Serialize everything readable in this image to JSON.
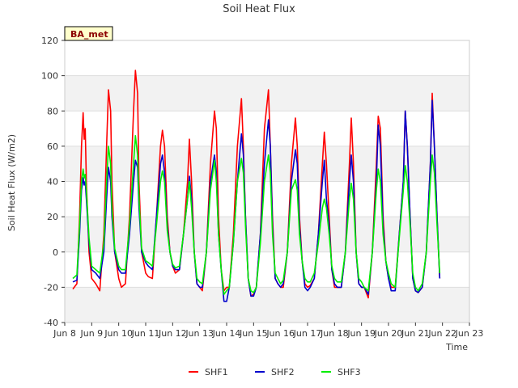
{
  "chart_data": {
    "type": "line",
    "title": "Soil Heat Flux",
    "xlabel": "Time",
    "ylabel": "Soil Heat Flux (W/m2)",
    "site_label": "BA_met",
    "ylim": [
      -40,
      120
    ],
    "yticks": [
      -40,
      -20,
      0,
      20,
      40,
      60,
      80,
      100,
      120
    ],
    "xlim": [
      8,
      23
    ],
    "xticks": [
      {
        "v": 8,
        "label": "Jun 8"
      },
      {
        "v": 9,
        "label": "Jun 9"
      },
      {
        "v": 10,
        "label": "Jun 10"
      },
      {
        "v": 11,
        "label": "Jun 11"
      },
      {
        "v": 12,
        "label": "Jun 12"
      },
      {
        "v": 13,
        "label": "Jun 13"
      },
      {
        "v": 14,
        "label": "Jun 14"
      },
      {
        "v": 15,
        "label": "Jun 15"
      },
      {
        "v": 16,
        "label": "Jun 16"
      },
      {
        "v": 17,
        "label": "Jun 17"
      },
      {
        "v": 18,
        "label": "Jun 18"
      },
      {
        "v": 19,
        "label": "Jun 19"
      },
      {
        "v": 20,
        "label": "Jun 20"
      },
      {
        "v": 21,
        "label": "Jun 21"
      },
      {
        "v": 22,
        "label": "Jun 22"
      },
      {
        "v": 23,
        "label": "Jun 23"
      }
    ],
    "grid": true,
    "legend_position": "bottom-center",
    "series": [
      {
        "name": "SHF1",
        "color": "#ff0000",
        "x": [
          8.3,
          8.45,
          8.55,
          8.62,
          8.68,
          8.72,
          8.76,
          8.8,
          8.9,
          9.0,
          9.15,
          9.3,
          9.45,
          9.55,
          9.62,
          9.7,
          9.75,
          9.85,
          10.0,
          10.1,
          10.25,
          10.4,
          10.55,
          10.62,
          10.7,
          10.75,
          10.85,
          11.0,
          11.1,
          11.25,
          11.4,
          11.55,
          11.62,
          11.7,
          11.8,
          11.9,
          12.0,
          12.1,
          12.25,
          12.4,
          12.55,
          12.62,
          12.7,
          12.8,
          12.9,
          13.0,
          13.1,
          13.25,
          13.4,
          13.55,
          13.62,
          13.7,
          13.8,
          13.9,
          14.0,
          14.1,
          14.25,
          14.4,
          14.55,
          14.62,
          14.7,
          14.8,
          14.9,
          15.0,
          15.1,
          15.25,
          15.4,
          15.55,
          15.62,
          15.7,
          15.8,
          15.9,
          16.0,
          16.1,
          16.25,
          16.4,
          16.55,
          16.62,
          16.7,
          16.8,
          16.9,
          17.0,
          17.1,
          17.25,
          17.4,
          17.55,
          17.62,
          17.7,
          17.8,
          17.9,
          18.0,
          18.1,
          18.25,
          18.4,
          18.55,
          18.62,
          18.7,
          18.8,
          18.9,
          19.0,
          19.1,
          19.25,
          19.4,
          19.55,
          19.62,
          19.7,
          19.8,
          19.9,
          20.0,
          20.1,
          20.25,
          20.4,
          20.55,
          20.62,
          20.7,
          20.8,
          20.9,
          21.0,
          21.1,
          21.25,
          21.4,
          21.55,
          21.62,
          21.7,
          21.8,
          21.9
        ],
        "y": [
          -21,
          -18,
          20,
          60,
          79,
          64,
          70,
          40,
          0,
          -15,
          -18,
          -22,
          10,
          60,
          92,
          80,
          40,
          0,
          -15,
          -20,
          -18,
          20,
          80,
          103,
          90,
          40,
          0,
          -12,
          -14,
          -15,
          20,
          60,
          69,
          60,
          20,
          0,
          -8,
          -12,
          -10,
          10,
          40,
          64,
          40,
          0,
          -18,
          -20,
          -22,
          0,
          50,
          80,
          70,
          20,
          -10,
          -22,
          -20,
          -20,
          10,
          60,
          87,
          60,
          20,
          -15,
          -25,
          -24,
          -20,
          10,
          70,
          92,
          60,
          20,
          -15,
          -18,
          -20,
          -20,
          0,
          50,
          76,
          60,
          20,
          -5,
          -18,
          -20,
          -19,
          -15,
          10,
          50,
          68,
          50,
          20,
          -10,
          -20,
          -20,
          -20,
          0,
          50,
          76,
          50,
          0,
          -18,
          -20,
          -20,
          -26,
          0,
          50,
          77,
          70,
          20,
          -5,
          -15,
          -20,
          -20,
          10,
          40,
          80,
          60,
          20,
          -15,
          -22,
          -23,
          -20,
          0,
          50,
          90,
          60,
          20,
          -15
        ]
      },
      {
        "name": "SHF2",
        "color": "#0000cc",
        "x": [
          8.3,
          8.45,
          8.55,
          8.62,
          8.68,
          8.72,
          8.76,
          8.8,
          8.9,
          9.0,
          9.15,
          9.3,
          9.45,
          9.55,
          9.62,
          9.7,
          9.75,
          9.85,
          10.0,
          10.1,
          10.25,
          10.4,
          10.55,
          10.62,
          10.7,
          10.75,
          10.85,
          11.0,
          11.1,
          11.25,
          11.4,
          11.55,
          11.62,
          11.7,
          11.8,
          11.9,
          12.0,
          12.1,
          12.25,
          12.4,
          12.55,
          12.62,
          12.7,
          12.8,
          12.9,
          13.0,
          13.1,
          13.25,
          13.4,
          13.55,
          13.62,
          13.7,
          13.8,
          13.9,
          14.0,
          14.1,
          14.25,
          14.4,
          14.55,
          14.62,
          14.7,
          14.8,
          14.9,
          15.0,
          15.1,
          15.25,
          15.4,
          15.55,
          15.62,
          15.7,
          15.8,
          15.9,
          16.0,
          16.1,
          16.25,
          16.4,
          16.55,
          16.62,
          16.7,
          16.8,
          16.9,
          17.0,
          17.1,
          17.25,
          17.4,
          17.55,
          17.62,
          17.7,
          17.8,
          17.9,
          18.0,
          18.1,
          18.25,
          18.4,
          18.55,
          18.62,
          18.7,
          18.8,
          18.9,
          19.0,
          19.1,
          19.25,
          19.4,
          19.55,
          19.62,
          19.7,
          19.8,
          19.9,
          20.0,
          20.1,
          20.25,
          20.4,
          20.55,
          20.62,
          20.7,
          20.8,
          20.9,
          21.0,
          21.1,
          21.25,
          21.4,
          21.55,
          21.62,
          21.7,
          21.8,
          21.9
        ],
        "y": [
          -17,
          -16,
          10,
          35,
          42,
          38,
          40,
          30,
          5,
          -10,
          -12,
          -15,
          0,
          30,
          48,
          40,
          20,
          0,
          -10,
          -12,
          -12,
          10,
          40,
          52,
          48,
          25,
          0,
          -6,
          -8,
          -10,
          20,
          50,
          55,
          45,
          15,
          0,
          -8,
          -10,
          -10,
          10,
          30,
          43,
          30,
          0,
          -18,
          -20,
          -20,
          0,
          40,
          55,
          45,
          10,
          -10,
          -28,
          -28,
          -20,
          5,
          40,
          67,
          55,
          20,
          -15,
          -25,
          -25,
          -20,
          10,
          50,
          75,
          60,
          15,
          -15,
          -18,
          -20,
          -18,
          0,
          40,
          58,
          50,
          15,
          -5,
          -20,
          -22,
          -20,
          -15,
          10,
          40,
          52,
          30,
          15,
          -10,
          -18,
          -20,
          -20,
          0,
          40,
          55,
          40,
          0,
          -18,
          -20,
          -20,
          -24,
          0,
          40,
          72,
          60,
          15,
          -5,
          -15,
          -22,
          -22,
          10,
          40,
          80,
          60,
          20,
          -15,
          -22,
          -23,
          -20,
          0,
          50,
          86,
          60,
          20,
          -15
        ]
      },
      {
        "name": "SHF3",
        "color": "#00ee00",
        "x": [
          8.3,
          8.45,
          8.55,
          8.62,
          8.68,
          8.72,
          8.76,
          8.8,
          8.9,
          9.0,
          9.15,
          9.3,
          9.45,
          9.55,
          9.62,
          9.7,
          9.75,
          9.85,
          10.0,
          10.1,
          10.25,
          10.4,
          10.55,
          10.62,
          10.7,
          10.75,
          10.85,
          11.0,
          11.1,
          11.25,
          11.4,
          11.55,
          11.62,
          11.7,
          11.8,
          11.9,
          12.0,
          12.1,
          12.25,
          12.4,
          12.55,
          12.62,
          12.7,
          12.8,
          12.9,
          13.0,
          13.1,
          13.25,
          13.4,
          13.55,
          13.62,
          13.7,
          13.8,
          13.9,
          14.0,
          14.1,
          14.25,
          14.4,
          14.55,
          14.62,
          14.7,
          14.8,
          14.9,
          15.0,
          15.1,
          15.25,
          15.4,
          15.55,
          15.62,
          15.7,
          15.8,
          15.9,
          16.0,
          16.1,
          16.25,
          16.4,
          16.55,
          16.62,
          16.7,
          16.8,
          16.9,
          17.0,
          17.1,
          17.25,
          17.4,
          17.55,
          17.62,
          17.7,
          17.8,
          17.9,
          18.0,
          18.1,
          18.25,
          18.4,
          18.55,
          18.62,
          18.7,
          18.8,
          18.9,
          19.0,
          19.1,
          19.25,
          19.4,
          19.55,
          19.62,
          19.7,
          19.8,
          19.9,
          20.0,
          20.1,
          20.25,
          20.4,
          20.55,
          20.62,
          20.7,
          20.8,
          20.9,
          21.0,
          21.1,
          21.25,
          21.4,
          21.55,
          21.62,
          21.7,
          21.8,
          21.9
        ],
        "y": [
          -15,
          -13,
          15,
          40,
          47,
          42,
          44,
          35,
          8,
          -8,
          -10,
          -12,
          5,
          40,
          60,
          50,
          25,
          2,
          -8,
          -10,
          -10,
          15,
          50,
          66,
          55,
          30,
          2,
          -5,
          -6,
          -8,
          15,
          40,
          46,
          40,
          12,
          0,
          -7,
          -9,
          -8,
          10,
          30,
          40,
          25,
          0,
          -15,
          -17,
          -18,
          0,
          35,
          52,
          40,
          10,
          -10,
          -24,
          -22,
          -20,
          5,
          40,
          53,
          45,
          15,
          -15,
          -22,
          -23,
          -20,
          5,
          40,
          55,
          45,
          10,
          -12,
          -15,
          -18,
          -16,
          0,
          35,
          41,
          35,
          10,
          -5,
          -15,
          -17,
          -17,
          -12,
          5,
          25,
          30,
          25,
          10,
          -8,
          -15,
          -17,
          -17,
          0,
          30,
          39,
          30,
          0,
          -15,
          -17,
          -20,
          -22,
          0,
          35,
          47,
          40,
          10,
          -5,
          -12,
          -18,
          -20,
          8,
          35,
          49,
          40,
          15,
          -12,
          -20,
          -22,
          -18,
          0,
          40,
          55,
          45,
          15,
          -12
        ]
      }
    ]
  }
}
